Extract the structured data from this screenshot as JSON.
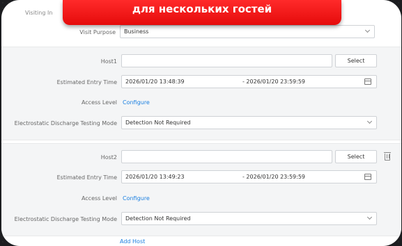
{
  "banner": {
    "text": "для нескольких гостей"
  },
  "section": {
    "title": "Visiting In"
  },
  "visit": {
    "purpose_label": "Visit Purpose",
    "purpose_value": "Business"
  },
  "hosts": [
    {
      "host_label": "Host1",
      "host_value": "",
      "select_label": "Select",
      "entry_label": "Estimated Entry Time",
      "entry_start": "2026/01/20 13:48:39",
      "entry_end": "- 2026/01/20 23:59:59",
      "access_label": "Access Level",
      "access_link": "Configure",
      "esd_label": "Electrostatic Discharge Testing Mode",
      "esd_value": "Detection Not Required"
    },
    {
      "host_label": "Host2",
      "host_value": "",
      "select_label": "Select",
      "entry_label": "Estimated Entry Time",
      "entry_start": "2026/01/20 13:49:23",
      "entry_end": "- 2026/01/20 23:59:59",
      "access_label": "Access Level",
      "access_link": "Configure",
      "esd_label": "Electrostatic Discharge Testing Mode",
      "esd_value": "Detection Not Required"
    }
  ],
  "footer": {
    "add_host": "Add Host"
  },
  "colors": {
    "banner": "#e50b0b",
    "link": "#1a7fe0",
    "panel": "#ffffff",
    "block": "#f4f5f6"
  },
  "icons": {
    "dropdown": "chevron-down-icon",
    "calendar": "calendar-icon",
    "delete": "trash-icon"
  }
}
